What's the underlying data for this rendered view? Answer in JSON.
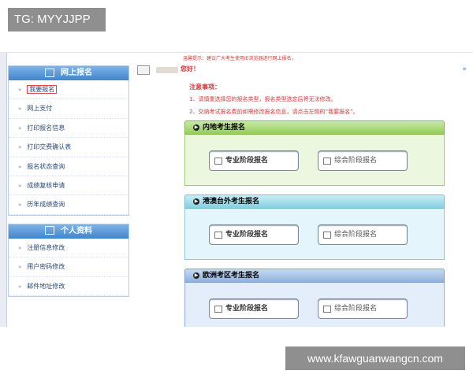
{
  "watermark_top": "TG: MYYJJPP",
  "watermark_bottom": "www.kfawguanwangcn.com",
  "header": {
    "notice": "温馨提示：建议广大考生使用IE浏览器进行网上报名。",
    "greeting": "您好！"
  },
  "notes": {
    "title": "注意事项：",
    "items": [
      "1、请慎重选择您的报名类型，报名类型选定后将无法修改。",
      "2、交纳考试报名费前如需修改报名信息，请点击左侧的“我要报名”。"
    ]
  },
  "sidebar": {
    "panels": [
      {
        "title": "网上报名",
        "items": [
          "我要报名",
          "网上支付",
          "打印报名信息",
          "打印交费确认表",
          "报名状态查询",
          "成绩复核申请",
          "历年成绩查询"
        ]
      },
      {
        "title": "个人资料",
        "items": [
          "注册信息修改",
          "用户密码修改",
          "邮件地址修改"
        ]
      }
    ]
  },
  "sections": [
    {
      "title": "内地考生报名",
      "buttons": [
        "专业阶段报名",
        "综合阶段报名"
      ]
    },
    {
      "title": "港澳台外考生报名",
      "buttons": [
        "专业阶段报名",
        "综合阶段报名"
      ]
    },
    {
      "title": "欧洲考区考生报名",
      "buttons": [
        "专业阶段报名",
        "综合阶段报名"
      ]
    }
  ],
  "icons": {
    "panel_icon": "monitor-icon",
    "section_icon": "arrow-right-circle-icon",
    "button_icon": "folder-icon",
    "bullet_icon": "chevron-right-icon"
  },
  "colors": {
    "accent_blue": "#3f85cf",
    "notice_red": "#d43a3a",
    "section1_green": "#94cc5c",
    "section2_cyan": "#86cfe0",
    "section3_blue": "#8fb0de"
  }
}
